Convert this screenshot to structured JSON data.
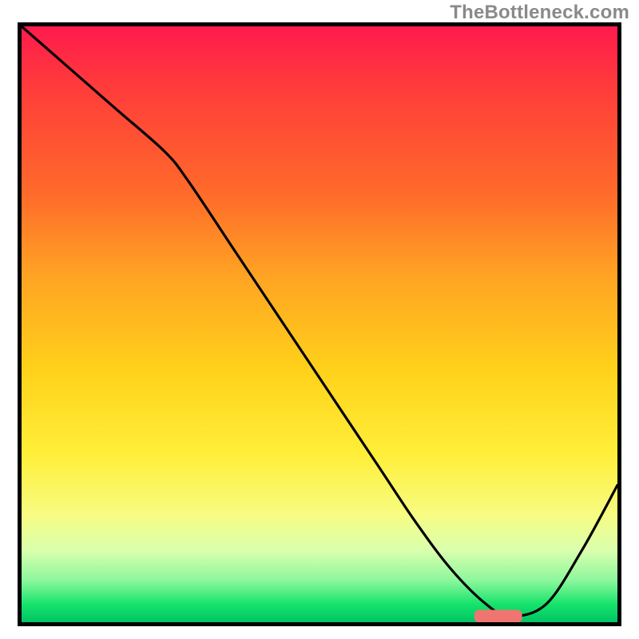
{
  "watermark": "TheBottleneck.com",
  "chart_data": {
    "type": "line",
    "title": "",
    "xlabel": "",
    "ylabel": "",
    "xlim": [
      0,
      100
    ],
    "ylim": [
      0,
      100
    ],
    "grid": false,
    "legend": false,
    "background_gradient": {
      "stops": [
        {
          "pos": 0.0,
          "color": "#ff1a4d"
        },
        {
          "pos": 0.28,
          "color": "#ff6a2a"
        },
        {
          "pos": 0.58,
          "color": "#ffd21a"
        },
        {
          "pos": 0.82,
          "color": "#f7fc82"
        },
        {
          "pos": 0.93,
          "color": "#8cf79c"
        },
        {
          "pos": 1.0,
          "color": "#00c465"
        }
      ]
    },
    "series": [
      {
        "name": "bottleneck-curve",
        "x": [
          0,
          8,
          16,
          24,
          28,
          36,
          44,
          52,
          60,
          66,
          72,
          78,
          82,
          88,
          94,
          100
        ],
        "y": [
          100,
          93,
          86,
          79,
          74,
          62,
          50,
          38,
          26,
          17,
          9,
          3,
          1,
          3,
          12,
          23
        ]
      }
    ],
    "optimum_marker": {
      "x_start": 76,
      "x_end": 84,
      "y": 1
    }
  }
}
